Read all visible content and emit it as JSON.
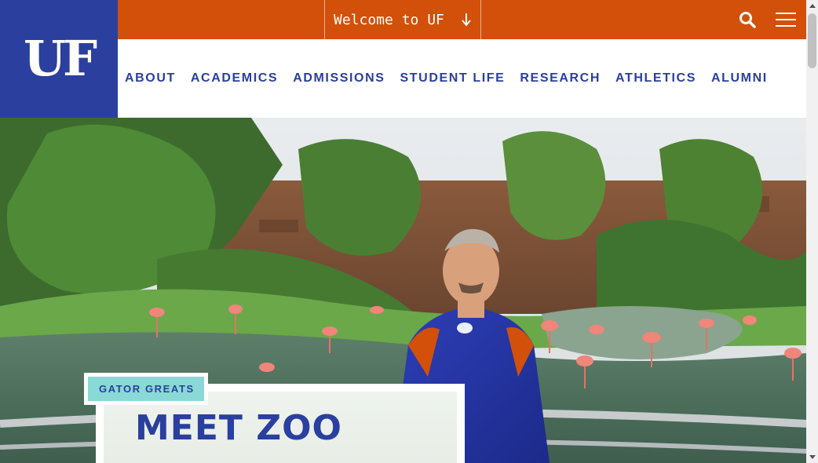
{
  "logo": {
    "text": "UF"
  },
  "topbar": {
    "welcome_label": "Welcome to UF",
    "welcome_icon": "arrow-down-icon",
    "search_icon": "search-icon",
    "menu_icon": "hamburger-menu-icon"
  },
  "nav": {
    "items": [
      {
        "label": "ABOUT"
      },
      {
        "label": "ACADEMICS"
      },
      {
        "label": "ADMISSIONS"
      },
      {
        "label": "STUDENT LIFE"
      },
      {
        "label": "RESEARCH"
      },
      {
        "label": "ATHLETICS"
      },
      {
        "label": "ALUMNI"
      }
    ]
  },
  "hero": {
    "category": "GATOR GREATS",
    "headline": "MEET ZOO"
  },
  "colors": {
    "brand_blue": "#2a3f9e",
    "brand_orange": "#d2500a",
    "label_teal": "#8ad9d6"
  }
}
